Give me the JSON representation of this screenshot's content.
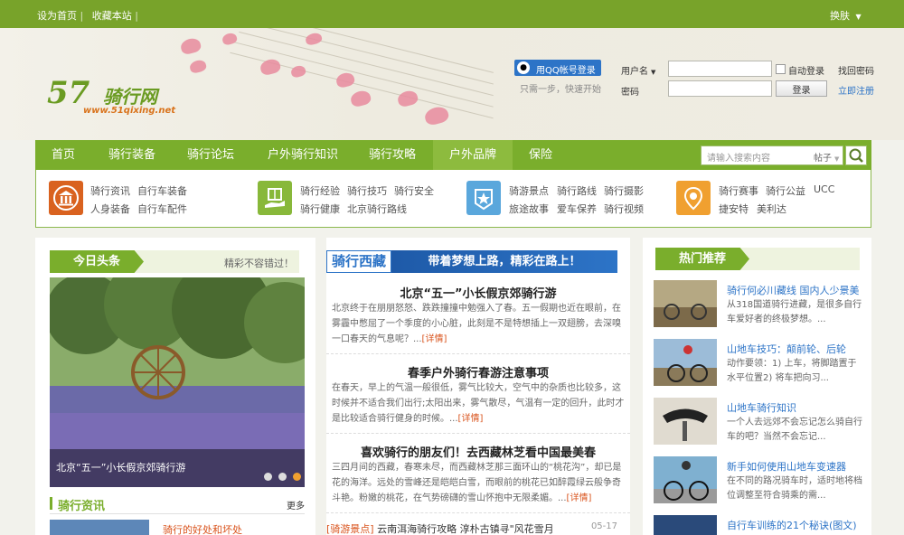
{
  "topbar": {
    "set_home": "设为首页",
    "sep1": "|",
    "bookmark": "收藏本站",
    "sep2": "|",
    "skin": "换肤"
  },
  "logo": {
    "number": "57",
    "name": "骑行网",
    "url": "www.51qixing.net"
  },
  "login": {
    "qq_button": "用QQ帐号登录",
    "qq_hint": "只需一步，快速开始",
    "username_label": "用户名",
    "password_label": "密码",
    "auto_login": "自动登录",
    "find_password": "找回密码",
    "login_button": "登录",
    "register": "立即注册"
  },
  "nav": {
    "items": [
      "首页",
      "骑行装备",
      "骑行论坛",
      "户外骑行知识",
      "骑行攻略",
      "户外品牌",
      "保险"
    ],
    "active_index": 5,
    "search_placeholder": "请输入搜索内容",
    "search_scope": "帖子"
  },
  "categories": [
    {
      "icon": "bank-icon",
      "color": "#d9621f",
      "links": [
        "骑行资讯",
        "自行车装备",
        "人身装备",
        "自行车配件"
      ]
    },
    {
      "icon": "hand-box-icon",
      "color": "#88b83a",
      "links": [
        "骑行经验",
        "骑行技巧",
        "骑行安全",
        "骑行健康",
        "北京骑行路线"
      ]
    },
    {
      "icon": "star-icon",
      "color": "#5aa7dc",
      "links": [
        "骑游景点",
        "骑行路线",
        "骑行摄影",
        "旅途故事",
        "爱车保养",
        "骑行视频"
      ]
    },
    {
      "icon": "location-pin-icon",
      "color": "#f0a030",
      "links": [
        "骑行赛事",
        "骑行公益",
        "UCC",
        "捷安特",
        "美利达"
      ]
    }
  ],
  "headlines": {
    "tab": "今日头条",
    "slogan": "精彩不容错过！",
    "hero_caption": "北京“五一”小长假京郊骑行游"
  },
  "news": {
    "tab": "骑行资讯",
    "more": "更多",
    "first_item": "骑行的好处和坏处"
  },
  "tibet": {
    "title": "骑行西藏",
    "banner": "带着梦想上路，精彩在路上！",
    "articles": [
      {
        "title": "北京“五一”小长假京郊骑行游",
        "text": "北京终于在朋朋怒怒、跌跌撞撞中勉强入了春。五一假期也近在眼前，在雾霾中憋屈了一个季度的小心脏，此刻是不是特想插上一双翅膀，去深嗅一口春天的气息呢？...",
        "detail": "[详情]"
      },
      {
        "title": "春季户外骑行春游注意事项",
        "text": "在春天，早上的气温一般很低，雾气比较大，空气中的杂质也比较多，这时候并不适合我们出行;太阳出来，雾气散尽，气温有一定的回升，此时才是比较适合骑行健身的时候。...",
        "detail": "[详情]"
      },
      {
        "title": "喜欢骑行的朋友们！去西藏林芝看中国最美春",
        "text": "三四月间的西藏，春寒未尽，而西藏林芝那三面环山的“桃花沟”，却已是花的海洋。远处的雪峰还是皑皑白雪，而眼前的桃花已如醉霞绿云般争奇斗艳。粉嫩的桃花，在气势磅礴的雪山怀抱中无限柔媚。...",
        "detail": "[详情]"
      }
    ],
    "list_item": {
      "tag": "[骑游景点]",
      "title": "云南洱海骑行攻略 淳朴古镇寻\"风花雪月",
      "date": "05-17"
    }
  },
  "hot": {
    "tab": "热门推荐",
    "items": [
      {
        "title": "骑行何必川藏线 国内人少景美",
        "desc": "从318国道骑行进藏，是很多自行车爱好者的终极梦想。..."
      },
      {
        "title": "山地车技巧：颠前轮、后轮",
        "desc": "动作要领：1) 上车，将脚踏置于水平位置2) 将车把向习..."
      },
      {
        "title": "山地车骑行知识",
        "desc": "一个人去远郊不会忘记怎么骑自行车的吧？当然不会忘记..."
      },
      {
        "title": "新手如何使用山地车变速器",
        "desc": "在不同的路况骑车时，适时地将档位调整至符合骑乘的需..."
      },
      {
        "title": "自行车训练的21个秘诀(图文)",
        "desc": ""
      }
    ]
  },
  "colors": {
    "brand_green": "#7aae2c",
    "link_blue": "#2d74c7",
    "accent_orange": "#d9531c"
  }
}
